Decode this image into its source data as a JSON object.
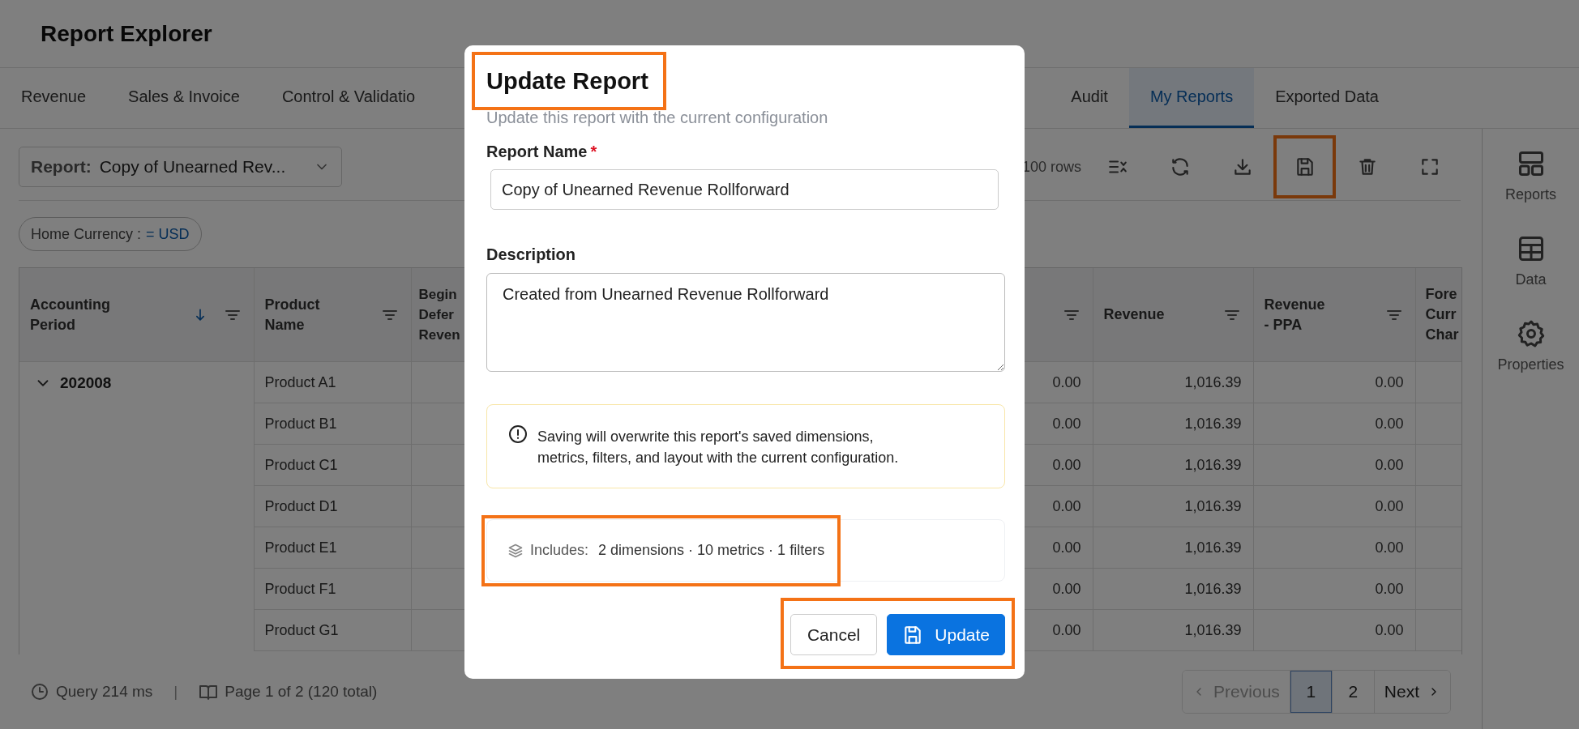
{
  "app": {
    "title": "Report Explorer"
  },
  "tabs": [
    {
      "label": "Revenue",
      "selected": false
    },
    {
      "label": "Sales & Invoice",
      "selected": false
    },
    {
      "label": "Control & Validatio",
      "selected": false
    },
    {
      "label": "Audit",
      "selected": false,
      "gap_before": true
    },
    {
      "label": "My Reports",
      "selected": true
    },
    {
      "label": "Exported Data",
      "selected": false
    }
  ],
  "toolbar": {
    "report_label": "Report:",
    "report_value": "Copy of Unearned Rev...",
    "row_count": "100 rows",
    "buttons": [
      {
        "kind": "columns",
        "highlighted": false
      },
      {
        "kind": "refresh",
        "highlighted": false
      },
      {
        "kind": "download",
        "highlighted": false
      },
      {
        "kind": "save",
        "highlighted": true
      },
      {
        "kind": "delete",
        "highlighted": false
      },
      {
        "kind": "fullscreen",
        "highlighted": false
      }
    ]
  },
  "filters": [
    {
      "label": "Home Currency :",
      "value": "= USD"
    }
  ],
  "table": {
    "columns": [
      {
        "label": "Accounting Period",
        "sorted_descending": true,
        "filter_icon": true
      },
      {
        "label": "Product Name",
        "filter_icon": true
      },
      {
        "label": "Begin Defer Reven",
        "filter_icon": false
      },
      {
        "filter_icon": true
      },
      {
        "label": "Revenue",
        "filter_icon": true
      },
      {
        "label": "Revenue - PPA",
        "filter_icon": true
      },
      {
        "label": "Fore Curr Char",
        "filter_icon": false
      }
    ],
    "groups": [
      {
        "period": "202008",
        "expanded": true,
        "rows": [
          [
            "Product A1",
            null,
            "0.00",
            "1,016.39",
            "0.00",
            null
          ],
          [
            "Product B1",
            null,
            "0.00",
            "1,016.39",
            "0.00",
            null
          ],
          [
            "Product C1",
            null,
            "0.00",
            "1,016.39",
            "0.00",
            null
          ],
          [
            "Product D1",
            null,
            "0.00",
            "1,016.39",
            "0.00",
            null
          ],
          [
            "Product E1",
            null,
            "0.00",
            "1,016.39",
            "0.00",
            null
          ],
          [
            "Product F1",
            null,
            "0.00",
            "1,016.39",
            "0.00",
            null
          ],
          [
            "Product G1",
            null,
            "0.00",
            "1,016.39",
            "0.00",
            null
          ]
        ]
      }
    ]
  },
  "status_bar": {
    "query": "Query 214 ms",
    "separator": "|",
    "page": "Page 1 of 2 (120 total)"
  },
  "pagination": [
    {
      "label": "Previous",
      "kind": "prev",
      "disabled": true,
      "selected": false
    },
    {
      "label": "1",
      "kind": "page",
      "selected": true
    },
    {
      "label": "2",
      "kind": "page",
      "selected": false
    },
    {
      "label": "Next",
      "kind": "next",
      "disabled": false,
      "selected": false
    }
  ],
  "sidebar": {
    "items": [
      {
        "label": "Reports",
        "kind": "layout"
      },
      {
        "label": "Data",
        "kind": "table"
      },
      {
        "label": "Properties",
        "kind": "gear"
      }
    ]
  },
  "dialog": {
    "title": "Update Report",
    "title_highlighted": true,
    "subtitle": "Update this report with the current configuration",
    "name_label": "Report Name",
    "required_mark": "*",
    "name_value": "Copy of Unearned Revenue Rollforward",
    "description_label": "Description",
    "description_value": "Created from Unearned Revenue Rollforward",
    "warning": "Saving will overwrite this report's saved dimensions, metrics, filters, and layout with the current configuration.",
    "includes_label": "Includes:",
    "includes_text": "2 dimensions · 10 metrics · 1 filters",
    "includes_highlighted": true,
    "buttons": [
      {
        "label": "Cancel",
        "kind": "secondary"
      },
      {
        "label": "Update",
        "kind": "primary"
      }
    ],
    "buttons_highlighted": true
  }
}
